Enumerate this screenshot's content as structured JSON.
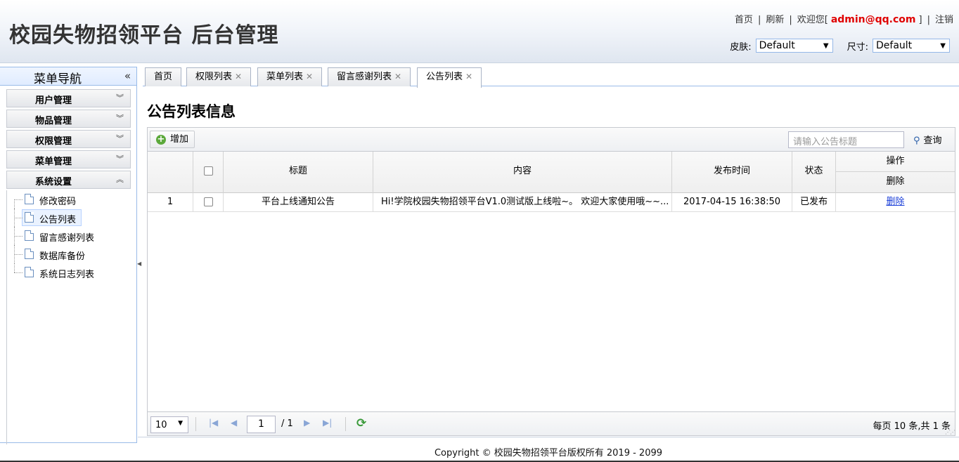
{
  "header": {
    "title": "校园失物招领平台 后台管理",
    "links": {
      "home": "首页",
      "sep": "|",
      "refresh": "刷新",
      "welcome": "欢迎您[",
      "user": "admin@qq.com",
      "welcome_end": "]",
      "logout": "注销"
    },
    "skin_label": "皮肤:",
    "skin_value": "Default",
    "size_label": "尺寸:",
    "size_value": "Default"
  },
  "sidebar": {
    "title": "菜单导航",
    "groups": [
      {
        "label": "用户管理"
      },
      {
        "label": "物品管理"
      },
      {
        "label": "权限管理"
      },
      {
        "label": "菜单管理"
      },
      {
        "label": "系统设置"
      }
    ],
    "tree": [
      {
        "label": "修改密码"
      },
      {
        "label": "公告列表"
      },
      {
        "label": "留言感谢列表"
      },
      {
        "label": "数据库备份"
      },
      {
        "label": "系统日志列表"
      }
    ]
  },
  "tabs": [
    {
      "label": "首页"
    },
    {
      "label": "权限列表"
    },
    {
      "label": "菜单列表"
    },
    {
      "label": "留言感谢列表"
    },
    {
      "label": "公告列表"
    }
  ],
  "page_title": "公告列表信息",
  "toolbar": {
    "add_label": "增加",
    "search_placeholder": "请输入公告标题",
    "search_label": "查询"
  },
  "table": {
    "columns": {
      "title": "标题",
      "content": "内容",
      "time": "发布时间",
      "status": "状态",
      "op": "操作",
      "op_delete": "删除"
    },
    "rows": [
      {
        "no": "1",
        "title": "平台上线通知公告",
        "content": "Hi!学院校园失物招领平台V1.0测试版上线啦~。 欢迎大家使用哦~~...",
        "time": "2017-04-15 16:38:50",
        "status": "已发布",
        "action": "删除"
      }
    ]
  },
  "pager": {
    "page_size": "10",
    "page": "1",
    "total_pages": "/ 1",
    "info": "每页 10 条,共 1 条"
  },
  "footer": "Copyright © 校园失物招领平台版权所有 2019 - 2099"
}
